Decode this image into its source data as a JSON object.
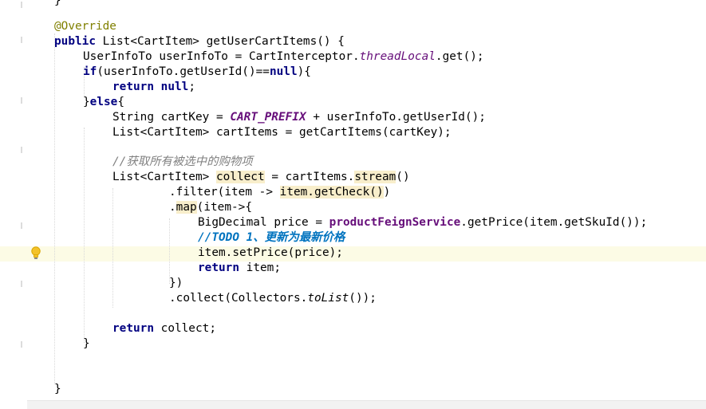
{
  "editor": {
    "caret_line_bg": "#fcfbe5",
    "comment_text": "//获取所有被选中的购物项",
    "todo_text": "//TODO 1、更新为最新价格",
    "lines": [
      {
        "t": "}"
      },
      {
        "t": "@Override"
      },
      {
        "t": "public List<CartItem> getUserCartItems() {"
      },
      {
        "t": "UserInfoTo userInfoTo = CartInterceptor.threadLocal.get();"
      },
      {
        "t": "if(userInfoTo.getUserId()==null){"
      },
      {
        "t": "return null;"
      },
      {
        "t": "}else{"
      },
      {
        "t": "String cartKey = CART_PREFIX + userInfoTo.getUserId();"
      },
      {
        "t": "List<CartItem> cartItems = getCartItems(cartKey);"
      },
      {
        "t": "List<CartItem> collect = cartItems.stream()"
      },
      {
        "t": ".filter(item -> item.getCheck())"
      },
      {
        "t": ".map(item->{"
      },
      {
        "t": "BigDecimal price = productFeignService.getPrice(item.getSkuId());"
      },
      {
        "t": "item.setPrice(price);"
      },
      {
        "t": "return item;"
      },
      {
        "t": "})"
      },
      {
        "t": ".collect(Collectors.toList());"
      },
      {
        "t": "return collect;"
      },
      {
        "t": "}"
      },
      {
        "t": "}"
      }
    ]
  }
}
